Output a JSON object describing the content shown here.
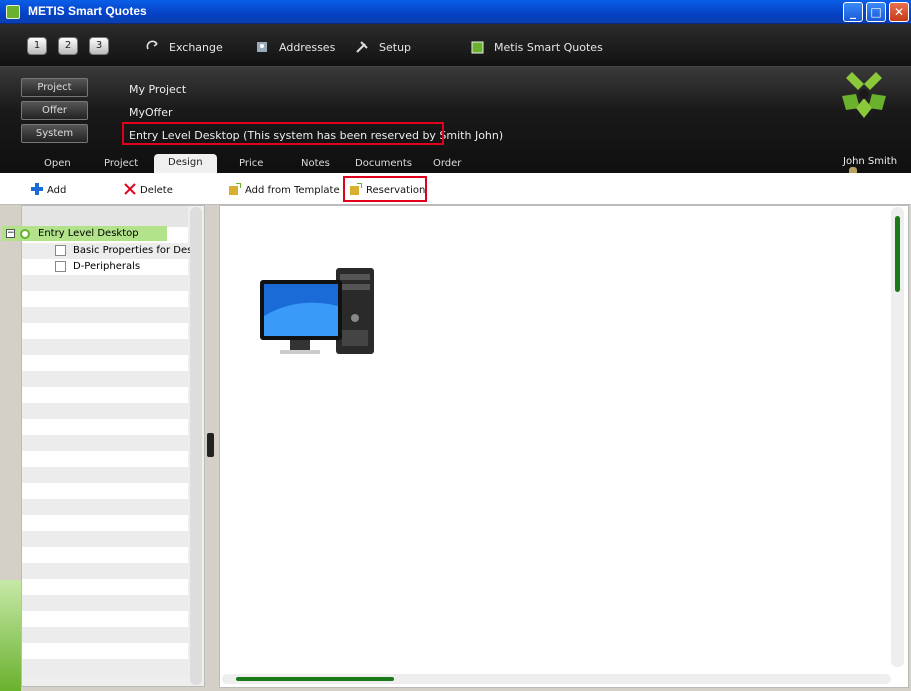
{
  "window": {
    "title": "METIS Smart Quotes"
  },
  "topbar": {
    "numbers": [
      "1",
      "2",
      "3"
    ],
    "items": [
      {
        "label": "Exchange",
        "icon": "exchange-icon"
      },
      {
        "label": "Addresses",
        "icon": "addresses-icon"
      },
      {
        "label": "Setup",
        "icon": "setup-icon"
      },
      {
        "label": "Metis Smart Quotes",
        "icon": "metis-icon"
      }
    ]
  },
  "header": {
    "buttons": [
      "Project",
      "Offer",
      "System"
    ],
    "project_name": "My Project",
    "offer_name": "MyOffer",
    "system_name": "Entry Level Desktop (This system has been reserved by  Smith John)",
    "user": "John Smith"
  },
  "tabs": [
    "Open",
    "Project",
    "Design",
    "Price",
    "Notes",
    "Documents",
    "Order"
  ],
  "active_tab": "Design",
  "actions": {
    "add": "Add",
    "delete": "Delete",
    "add_from_template": "Add from Template",
    "reservation": "Reservation"
  },
  "tree": {
    "root": "Entry Level Desktop",
    "children": [
      "Basic Properties for Desk",
      "D-Peripherals"
    ]
  },
  "colors": {
    "accent": "#6ab12e",
    "highlight": "#e0001b",
    "scroll": "#1a7a1a"
  }
}
